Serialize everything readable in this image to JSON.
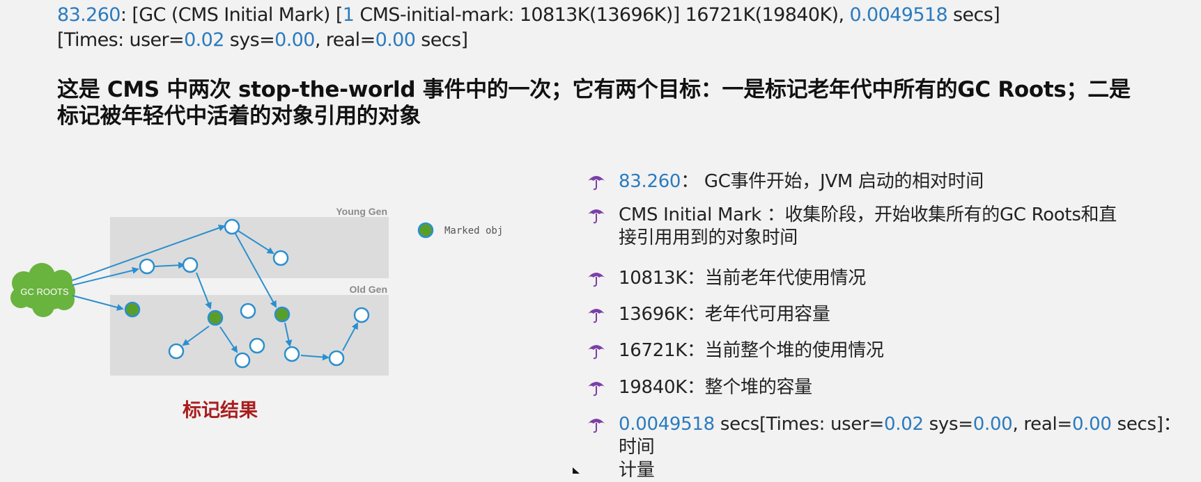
{
  "log": {
    "line1": {
      "p1": "83.260",
      "p2": ": [GC (CMS Initial Mark) [",
      "p3": "1",
      "p4": " CMS-initial-mark: 10813K(13696K)] 16721K(19840K), ",
      "p5": "0.0049518",
      "p6": " secs]"
    },
    "line2": {
      "p1": "[Times: user=",
      "p2": "0.02",
      "p3": " sys=",
      "p4": "0.00",
      "p5": ", real=",
      "p6": "0.00",
      "p7": " secs]"
    }
  },
  "heading": {
    "line1": "这是 CMS 中两次 stop-the-world 事件中的一次；它有两个目标：一是标记老年代中所有的GC Roots；二是",
    "line2": "标记被年轻代中活着的对象引用的对象"
  },
  "diagram": {
    "young_gen_label": "Young Gen",
    "old_gen_label": "Old Gen",
    "gc_roots_label": "GC ROOTS",
    "legend_label": "Marked obj",
    "colors": {
      "marked_fill": "#5a9e2a",
      "node_stroke": "#2b8fce",
      "arrow": "#2b8fce",
      "cloud": "#69b33f",
      "band": "#dcdcdc"
    }
  },
  "result_title": "标记结果",
  "bullet_icon": "umbrella-icon",
  "bullet_color": "#7b3fa8",
  "bullets": {
    "b1": {
      "num": "83.260",
      "text": "： GC事件开始，JVM 启动的相对时间"
    },
    "b2": {
      "line1": "CMS Initial Mark ：收集阶段，开始收集所有的GC Roots和直",
      "line2": "接引用用到的对象时间"
    },
    "b3": {
      "text": "10813K：当前老年代使用情况"
    },
    "b4": {
      "text": "13696K：老年代可用容量"
    },
    "b5": {
      "text": "16721K：当前整个堆的使用情况"
    },
    "b6": {
      "text": "19840K：整个堆的容量"
    },
    "b7": {
      "p1": "0.0049518",
      "p2": " secs[Times: user=",
      "p3": "0.02",
      "p4": " sys=",
      "p5": "0.00",
      "p6": ", real=",
      "p7": "0.00",
      "p8": " secs]：时间",
      "line2": "计量"
    }
  }
}
